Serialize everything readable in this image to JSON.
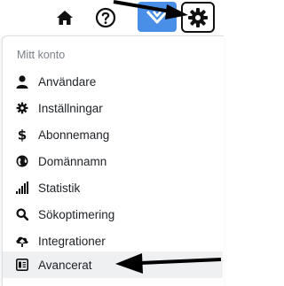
{
  "topbar": {
    "icons": [
      "home-icon",
      "help-icon",
      "brand-logo-icon",
      "gear-icon"
    ],
    "brand_color": "#4a8fe7"
  },
  "menu": {
    "title": "Mitt konto",
    "items": [
      {
        "label": "Användare",
        "icon": "user-icon"
      },
      {
        "label": "Inställningar",
        "icon": "cog-icon"
      },
      {
        "label": "Abonnemang",
        "icon": "dollar-icon"
      },
      {
        "label": "Domännamn",
        "icon": "globe-icon"
      },
      {
        "label": "Statistik",
        "icon": "signal-bars-icon"
      },
      {
        "label": "Sökoptimering",
        "icon": "search-icon"
      },
      {
        "label": "Integrationer",
        "icon": "cloud-upload-icon"
      },
      {
        "label": "Avancerat",
        "icon": "advanced-icon",
        "highlighted": true
      }
    ]
  }
}
